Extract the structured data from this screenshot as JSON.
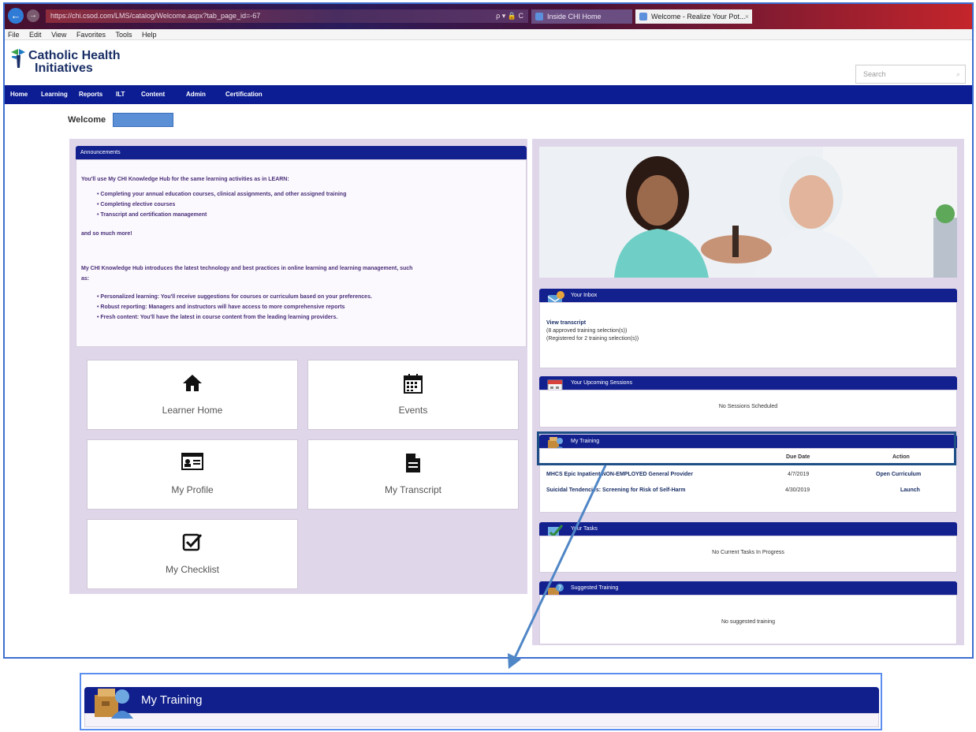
{
  "browser": {
    "address": "https://chi.csod.com/LMS/catalog/Welcome.aspx?tab_page_id=-67",
    "address_tools": "ρ ▾ 🔒 C",
    "tabs": [
      {
        "label": "Inside CHI Home"
      },
      {
        "label": "Welcome - Realize Your Pot...",
        "close": "×"
      }
    ],
    "menu": [
      "File",
      "Edit",
      "View",
      "Favorites",
      "Tools",
      "Help"
    ]
  },
  "site": {
    "logo_line1": "Catholic Health",
    "logo_line2": "Initiatives",
    "search_placeholder": "Search",
    "nav": [
      "Home",
      "Learning",
      "Reports",
      "ILT",
      "Content",
      "Admin",
      "Certification"
    ],
    "welcome": "Welcome"
  },
  "announcements": {
    "title": "Announcements",
    "intro": "You'll use My CHI Knowledge Hub for the same learning activities as in LEARN:",
    "list1": [
      "Completing your annual education courses, clinical assignments, and other assigned training",
      "Completing elective courses",
      "Transcript and certification management"
    ],
    "more": "and so much more!",
    "para2_line1": "My CHI Knowledge Hub introduces the latest technology and best practices in online learning and learning management, such",
    "para2_line2": "as:",
    "list2": [
      "Personalized learning: You'll receive suggestions for courses or curriculum based on your preferences.",
      "Robust reporting: Managers and instructors will have access to more comprehensive reports",
      "Fresh content: You'll have the latest in course content from the leading learning providers."
    ]
  },
  "tiles": [
    {
      "label": "Learner Home",
      "icon": "home-icon"
    },
    {
      "label": "Events",
      "icon": "calendar-icon"
    },
    {
      "label": "My Profile",
      "icon": "id-card-icon"
    },
    {
      "label": "My Transcript",
      "icon": "document-icon"
    },
    {
      "label": "My Checklist",
      "icon": "checkbox-icon"
    }
  ],
  "inbox": {
    "title": "Your Inbox",
    "link": "View transcript",
    "approved": "(8 approved training selection(s))",
    "registered": "(Registered for 2 training selection(s))"
  },
  "sessions": {
    "title": "Your Upcoming Sessions",
    "empty": "No Sessions Scheduled"
  },
  "training": {
    "title": "My Training",
    "col_due": "Due Date",
    "col_action": "Action",
    "rows": [
      {
        "name": "MHCS Epic Inpatient NON-EMPLOYED General Provider",
        "due": "4/7/2019",
        "action": "Open Curriculum"
      },
      {
        "name": "Suicidal Tendencies: Screening for Risk of Self-Harm",
        "due": "4/30/2019",
        "action": "Launch"
      }
    ]
  },
  "tasks": {
    "title": "Your Tasks",
    "empty": "No Current Tasks In Progress"
  },
  "suggested": {
    "title": "Suggested Training",
    "empty": "No suggested training"
  },
  "zoom": {
    "title": "My Training"
  },
  "colors": {
    "nav_blue": "#0c1d93",
    "widget_header": "#13218f",
    "panel_lavender": "#e0d6ea",
    "highlight_border": "#1e4f86",
    "callout_arrow": "#4f86c6"
  }
}
